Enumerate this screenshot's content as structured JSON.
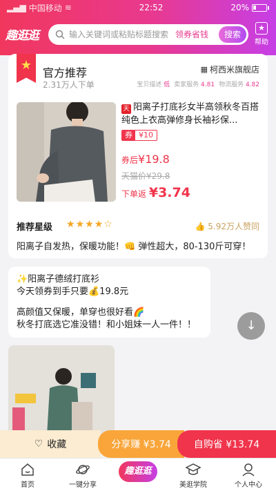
{
  "status": {
    "carrier": "中国移动",
    "time": "22:52",
    "battery": "20%"
  },
  "header": {
    "logo": "趣逛逛",
    "search_placeholder": "输入关键词或粘贴标题搜索",
    "coupon_hint": "领券省钱",
    "search_button": "搜索",
    "help_label": "帮助",
    "help_icon": "book-icon"
  },
  "card": {
    "title": "官方推荐",
    "subtitle": "2.31万人下单",
    "store": "柯西米旗舰店",
    "ratings": [
      {
        "label": "宝贝描述",
        "level": "低",
        "score": ""
      },
      {
        "label": "卖家服务",
        "level": "",
        "score": "4.81"
      },
      {
        "label": "物流服务",
        "level": "",
        "score": "4.82"
      }
    ],
    "product": {
      "platform_badge": "天",
      "title": "阳离子打底衫女半高领秋冬百搭纯色上衣高弹修身长袖衫保...",
      "coupon_tag": "券",
      "coupon_value": "¥10",
      "after_coupon_label": "券后",
      "after_coupon_value": "¥19.8",
      "tmall_price": "天猫价¥29.8",
      "rebate_label": "下单返",
      "rebate_value": "¥3.74"
    },
    "rating_label": "推荐星级",
    "stars": 4,
    "max_stars": 5,
    "likes": "5.92万人赞同",
    "description": "阳离子自发热，保暖功能！👊 弹性超大，80-130斤可穿！"
  },
  "message": {
    "line1": "✨阳离子德绒打底衫",
    "line2": "今天领券到手只要💰19.8元",
    "line3": "高颜值又保暖，单穿也很好看🌈",
    "line4": "秋冬打底选它准没错！和小姐妹一人一件！！"
  },
  "actions": {
    "favorite": "收藏",
    "share": "分享赚 ¥3.74",
    "self_buy": "自购省 ¥13.74"
  },
  "tabs": [
    {
      "label": "首页",
      "icon": "home-icon"
    },
    {
      "label": "一键分享",
      "icon": "planet-icon"
    },
    {
      "label": "趣逛逛",
      "icon": "logo"
    },
    {
      "label": "美逛学院",
      "icon": "graduation-cap-icon"
    },
    {
      "label": "个人中心",
      "icon": "user-icon"
    }
  ],
  "colors": {
    "brand_pink": "#f1375d",
    "brand_purple": "#c63fe6",
    "price_red": "#f0344b",
    "share_orange": "#f9a53a"
  }
}
